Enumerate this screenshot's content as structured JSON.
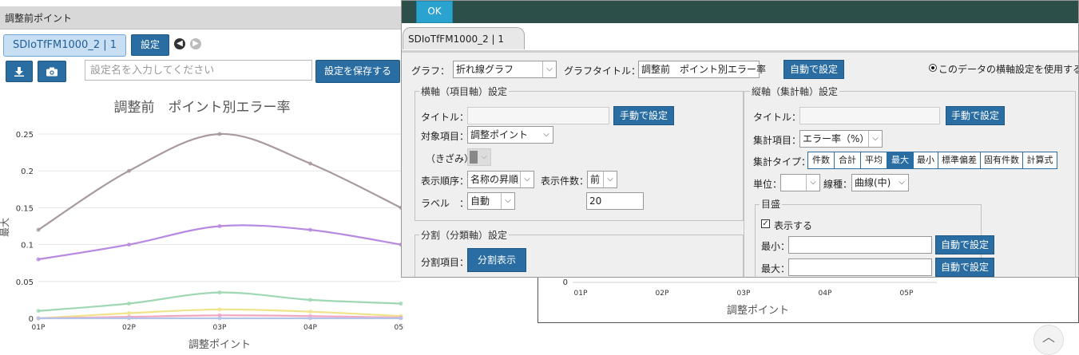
{
  "left": {
    "header_title": "調整前ポイント",
    "tab_label": "SDIoTfFM1000_2 | 1",
    "settings_button": "設定",
    "download_icon": "download-icon",
    "camera_icon": "camera-icon",
    "settings_name_placeholder": "設定名を入力してください",
    "save_button": "設定を保存する"
  },
  "chart_data": [
    {
      "type": "line",
      "title": "調整前　ポイント別エラー率",
      "xlabel": "調整ポイント",
      "ylabel": "最大",
      "categories": [
        "01P",
        "02P",
        "03P",
        "04P",
        "05P"
      ],
      "yticks": [
        "0.25",
        "0.2",
        "0.15",
        "0.1",
        "0.05",
        "0"
      ],
      "ylim": [
        0,
        0.25
      ],
      "grid": true,
      "series": [
        {
          "color": "#a89a9c",
          "values": [
            0.12,
            0.2,
            0.25,
            0.21,
            0.15
          ]
        },
        {
          "color": "#b889e0",
          "values": [
            0.08,
            0.1,
            0.125,
            0.12,
            0.1
          ]
        },
        {
          "color": "#9fd7b2",
          "values": [
            0.01,
            0.02,
            0.035,
            0.025,
            0.02
          ]
        },
        {
          "color": "#f0e38a",
          "values": [
            0.0,
            0.007,
            0.012,
            0.009,
            0.003
          ]
        },
        {
          "color": "#f3a6c4",
          "values": [
            0.0,
            0.002,
            0.004,
            0.003,
            0.001
          ]
        },
        {
          "color": "#b4c4e8",
          "values": [
            0.0,
            0.0,
            0.0,
            0.0,
            0.0
          ]
        }
      ]
    },
    {
      "type": "line",
      "xlabel": "調整ポイント",
      "categories": [
        "01P",
        "02P",
        "03P",
        "04P",
        "05P"
      ],
      "yticks": [
        "0"
      ],
      "series": []
    }
  ],
  "modal": {
    "ok_button": "OK",
    "tab_label": "SDIoTfFM1000_2 | 1",
    "graph_label": "グラフ：",
    "graph_type": "折れ線グラフ",
    "graph_title_label": "グラフタイトル：",
    "graph_title_value": "調整前　ポイント別エラー率",
    "auto_set_button": "自動で設定",
    "use_setting_label": "このデータの横軸設定を使用する",
    "x_axis": {
      "group_title": "横軸（項目軸）設定",
      "title_label": "タイトル：",
      "title_value": "",
      "manual_button": "手動で設定",
      "target_label": "対象項目：",
      "target_value": "調整ポイント",
      "interval_label": "（きざみ）",
      "order_label": "表示順序：",
      "order_value": "名称の昇順",
      "count_label": "表示件数：",
      "count_value": "前",
      "label_label": "ラベル　：",
      "label_value": "自動",
      "count_number": "20"
    },
    "split": {
      "group_title": "分割（分類軸）設定",
      "item_label": "分割項目：",
      "button": "分割表示"
    },
    "y_axis": {
      "group_title": "縦軸（集計軸）設定",
      "title_label": "タイトル：",
      "title_value": "",
      "manual_button": "手動で設定",
      "agg_item_label": "集計項目：",
      "agg_item_value": "エラー率（%）",
      "agg_type_label": "集計タイプ：",
      "agg_types": [
        {
          "label": "件数",
          "active": false
        },
        {
          "label": "合計",
          "active": false
        },
        {
          "label": "平均",
          "active": false
        },
        {
          "label": "最大",
          "active": true
        },
        {
          "label": "最小",
          "active": false
        },
        {
          "label": "標準偏差",
          "active": false
        },
        {
          "label": "固有件数",
          "active": false
        },
        {
          "label": "計算式",
          "active": false
        }
      ],
      "unit_label": "単位：",
      "unit_value": "",
      "line_label": "線種：",
      "line_value": "曲線(中)",
      "scale_title": "目盛",
      "show_label": "表示する",
      "min_label": "最小：",
      "max_label": "最大：",
      "auto_button": "自動で設定"
    }
  },
  "scroll_top_icon": "chevron-up-icon"
}
